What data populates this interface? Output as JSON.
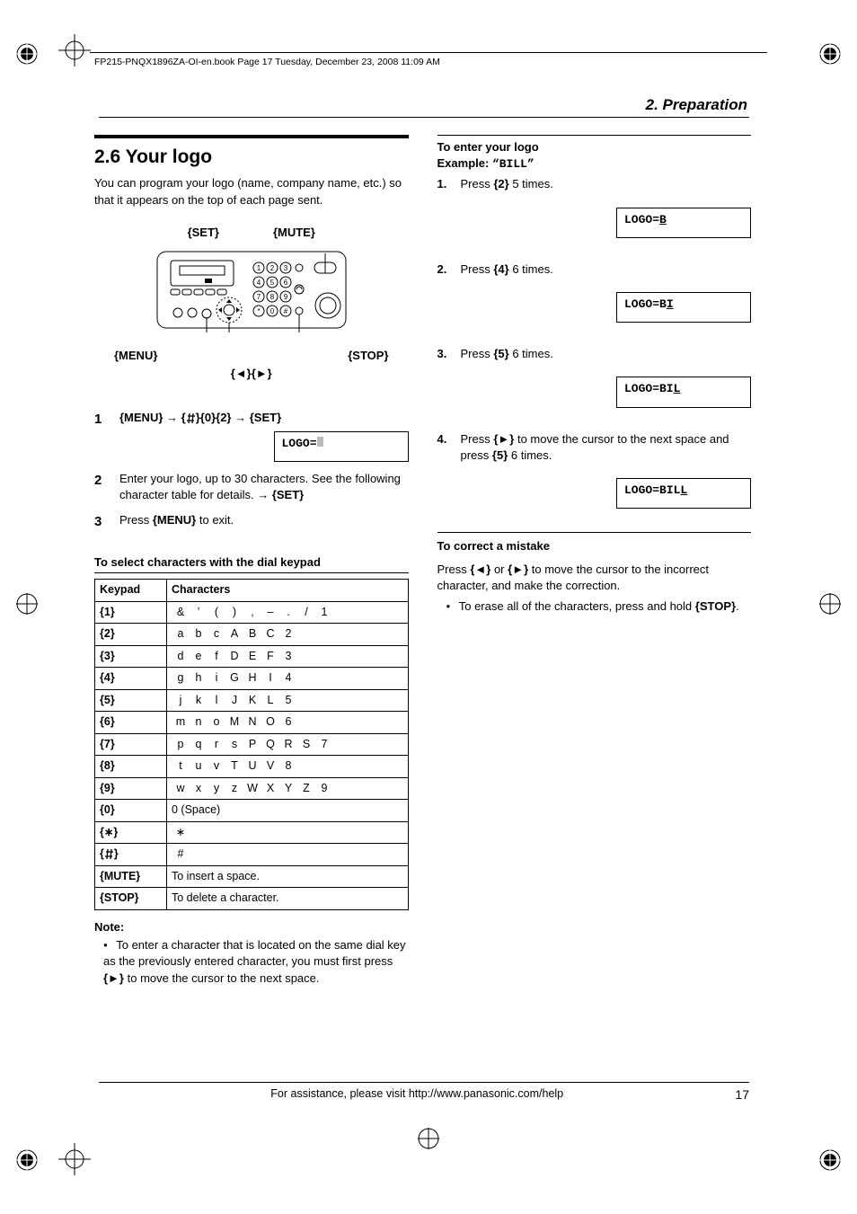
{
  "header": {
    "running": "FP215-PNQX1896ZA-OI-en.book  Page 17  Tuesday, December 23, 2008  11:09 AM",
    "breadcrumb": "2. Preparation"
  },
  "left": {
    "section_title": "2.6 Your logo",
    "intro": "You can program your logo (name, company name, etc.) so that it appears on the top of each page sent.",
    "device_labels": {
      "set": "{SET}",
      "mute": "{MUTE}",
      "menu": "{MENU}",
      "stop": "{STOP}",
      "arrows": "{◄}{►}"
    },
    "steps": [
      {
        "num": "1",
        "body_html": "{MENU} → {#}{0}{2} → {SET}",
        "menu": "{MENU}",
        "set": "{SET}",
        "zero": "{0}",
        "two": "{2}",
        "arrow": "→",
        "lcd": "LOGO="
      },
      {
        "num": "2",
        "body": "Enter your logo, up to 30 characters. See the following character table for details. → ",
        "set": "{SET}"
      },
      {
        "num": "3",
        "body_a": "Press ",
        "menu": "{MENU}",
        "body_b": " to exit."
      }
    ],
    "char_heading": "To select characters with the dial keypad",
    "char_table": {
      "head_keypad": "Keypad",
      "head_chars": "Characters",
      "rows": [
        {
          "key": "{1}",
          "chars": [
            "&",
            "’",
            "(",
            ")",
            ",",
            "–",
            ".",
            "/",
            "1"
          ]
        },
        {
          "key": "{2}",
          "chars": [
            "a",
            "b",
            "c",
            "A",
            "B",
            "C",
            "2"
          ]
        },
        {
          "key": "{3}",
          "chars": [
            "d",
            "e",
            "f",
            "D",
            "E",
            "F",
            "3"
          ]
        },
        {
          "key": "{4}",
          "chars": [
            "g",
            "h",
            "i",
            "G",
            "H",
            "I",
            "4"
          ]
        },
        {
          "key": "{5}",
          "chars": [
            "j",
            "k",
            "l",
            "J",
            "K",
            "L",
            "5"
          ]
        },
        {
          "key": "{6}",
          "chars": [
            "m",
            "n",
            "o",
            "M",
            "N",
            "O",
            "6"
          ]
        },
        {
          "key": "{7}",
          "chars": [
            "p",
            "q",
            "r",
            "s",
            "P",
            "Q",
            "R",
            "S",
            "7"
          ]
        },
        {
          "key": "{8}",
          "chars": [
            "t",
            "u",
            "v",
            "T",
            "U",
            "V",
            "8"
          ]
        },
        {
          "key": "{9}",
          "chars": [
            "w",
            "x",
            "y",
            "z",
            "W",
            "X",
            "Y",
            "Z",
            "9"
          ]
        },
        {
          "key": "{0}",
          "chars_text": "0     (Space)"
        },
        {
          "key": "{∗}",
          "chars": [
            "∗"
          ]
        },
        {
          "key": "{#}",
          "chars": [
            "#"
          ],
          "sharp_icon": true
        },
        {
          "key": "{MUTE}",
          "chars_text": "To insert a space."
        },
        {
          "key": "{STOP}",
          "chars_text": "To delete a character."
        }
      ]
    },
    "note_label": "Note:",
    "note_bullet_a": "To enter a character that is located on the same dial key as the previously entered character, you must first press ",
    "note_right_arrow": "{►}",
    "note_bullet_b": " to move the cursor to the next space."
  },
  "right": {
    "enter_heading": "To enter your logo",
    "example_label": "Example: ",
    "example_value": "“BILL”",
    "steps": [
      {
        "num": "1.",
        "a": "Press ",
        "k": "{2}",
        "b": " 5 times.",
        "lcd": "LOGO=B",
        "last": "B"
      },
      {
        "num": "2.",
        "a": "Press ",
        "k": "{4}",
        "b": " 6 times.",
        "lcd": "LOGO=BI",
        "last": "I"
      },
      {
        "num": "3.",
        "a": "Press ",
        "k": "{5}",
        "b": " 6 times.",
        "lcd": "LOGO=BIL",
        "last": "L"
      },
      {
        "num": "4.",
        "a": "Press ",
        "k1": "{►}",
        "mid": " to move the cursor to the next space and press ",
        "k2": "{5}",
        "b": " 6 times.",
        "lcd": "LOGO=BILL",
        "last": "L"
      }
    ],
    "correct_heading": "To correct a mistake",
    "correct_a": "Press ",
    "left_arrow": "{◄}",
    "or": " or ",
    "right_arrow": "{►}",
    "correct_b": " to move the cursor to the incorrect character, and make the correction.",
    "erase_a": "To erase all of the characters, press and hold ",
    "stop": "{STOP}",
    "erase_b": "."
  },
  "footer": {
    "assist": "For assistance, please visit http://www.panasonic.com/help",
    "page": "17"
  }
}
